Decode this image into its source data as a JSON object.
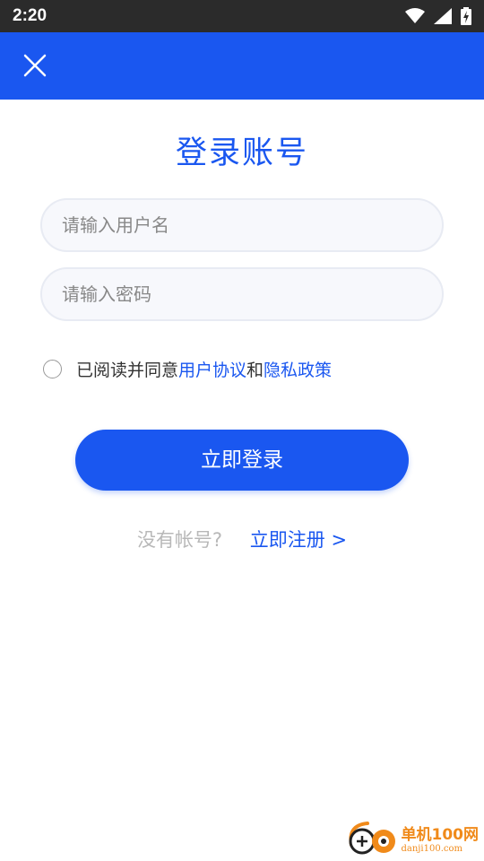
{
  "status_bar": {
    "time": "2:20",
    "icons": [
      "wifi-icon",
      "signal-icon",
      "battery-charging-icon"
    ]
  },
  "app_bar": {
    "close_icon": "close-icon",
    "color": "#1a57f0"
  },
  "title": "登录账号",
  "form": {
    "username_placeholder": "请输入用户名",
    "password_placeholder": "请输入密码",
    "agreement": {
      "prefix": "已阅读并同意",
      "user_agreement": "用户协议",
      "connector": "和",
      "privacy_policy": "隐私政策",
      "checked": false
    },
    "login_button": "立即登录"
  },
  "register": {
    "question": "没有帐号?",
    "link": "立即注册 >"
  },
  "watermark": {
    "name": "单机100网",
    "domain": "danji100.com"
  },
  "colors": {
    "accent": "#1a57f0",
    "status_bar": "#2b2b2b"
  }
}
